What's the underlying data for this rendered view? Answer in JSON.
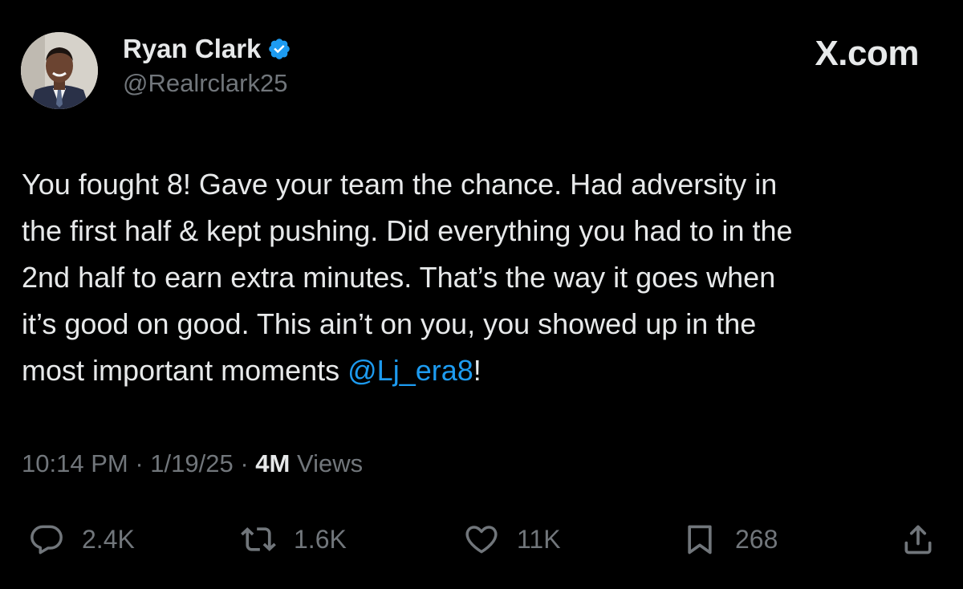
{
  "author": {
    "name": "Ryan Clark",
    "handle": "@Realrclark25",
    "verified": true
  },
  "brand": "X.com",
  "tweet": {
    "text_main": "You fought 8! Gave your team the chance. Had adversity in\nthe first half & kept pushing. Did everything you had to in the\n2nd half to earn extra minutes. That’s the way it goes when\nit’s good on good. This ain’t on you, you showed up in the\nmost important moments ",
    "mention": "@Lj_era8",
    "text_end": "!"
  },
  "meta": {
    "time": "10:14 PM",
    "separator1": " · ",
    "date": "1/19/25",
    "separator2": " · ",
    "views_count": "4M",
    "views_label": " Views"
  },
  "actions": {
    "replies": "2.4K",
    "reposts": "1.6K",
    "likes": "11K",
    "bookmarks": "268"
  },
  "colors": {
    "background": "#000000",
    "text": "#e7e9ea",
    "secondary": "#71767b",
    "accent": "#1d9bf0"
  },
  "icons": [
    "verified-badge-icon",
    "reply-icon",
    "repost-icon",
    "like-icon",
    "bookmark-icon",
    "share-icon"
  ]
}
